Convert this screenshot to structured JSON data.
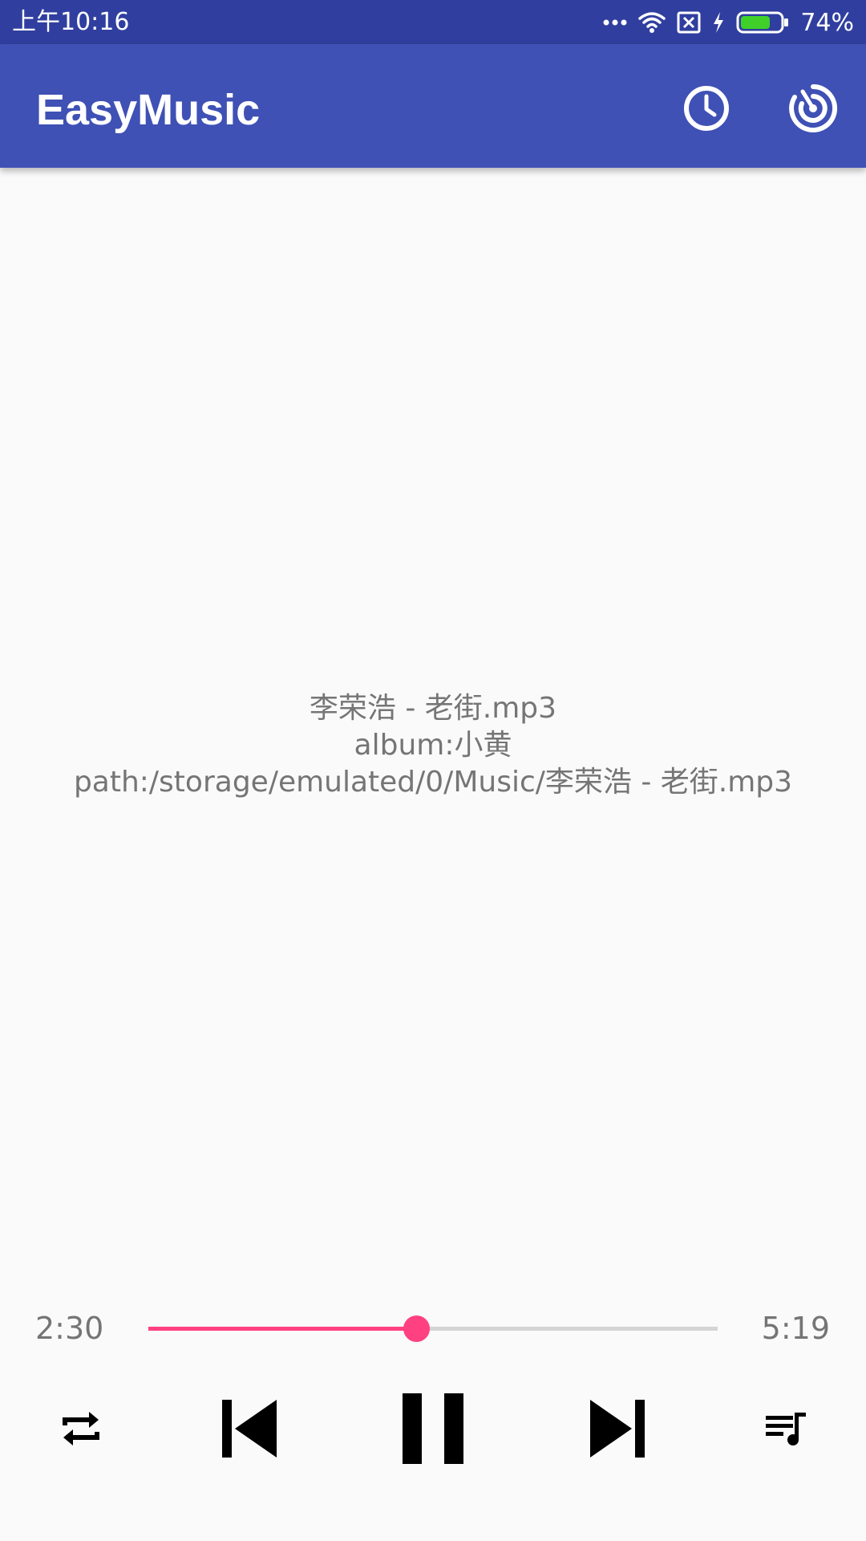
{
  "status_bar": {
    "time": "上午10:16",
    "battery_percent": "74%",
    "battery_level": 0.74,
    "icons": [
      "more-dots-icon",
      "wifi-icon",
      "no-sim-icon",
      "charging-icon",
      "battery-icon"
    ]
  },
  "app_bar": {
    "title": "EasyMusic",
    "actions": [
      "timer-icon",
      "radar-icon"
    ]
  },
  "song": {
    "title": "李荣浩 - 老街.mp3",
    "album": "album:小黄",
    "path": "path:/storage/emulated/0/Music/李荣浩 - 老街.mp3"
  },
  "progress": {
    "current": "2:30",
    "total": "5:19",
    "fraction": 0.47
  },
  "controls": [
    "repeat-icon",
    "skip-previous-icon",
    "pause-icon",
    "skip-next-icon",
    "playlist-icon"
  ],
  "colors": {
    "status_bar": "#303f9f",
    "app_bar": "#3f51b5",
    "accent": "#ff4081",
    "background": "#fafafa",
    "text_secondary": "#757575"
  }
}
